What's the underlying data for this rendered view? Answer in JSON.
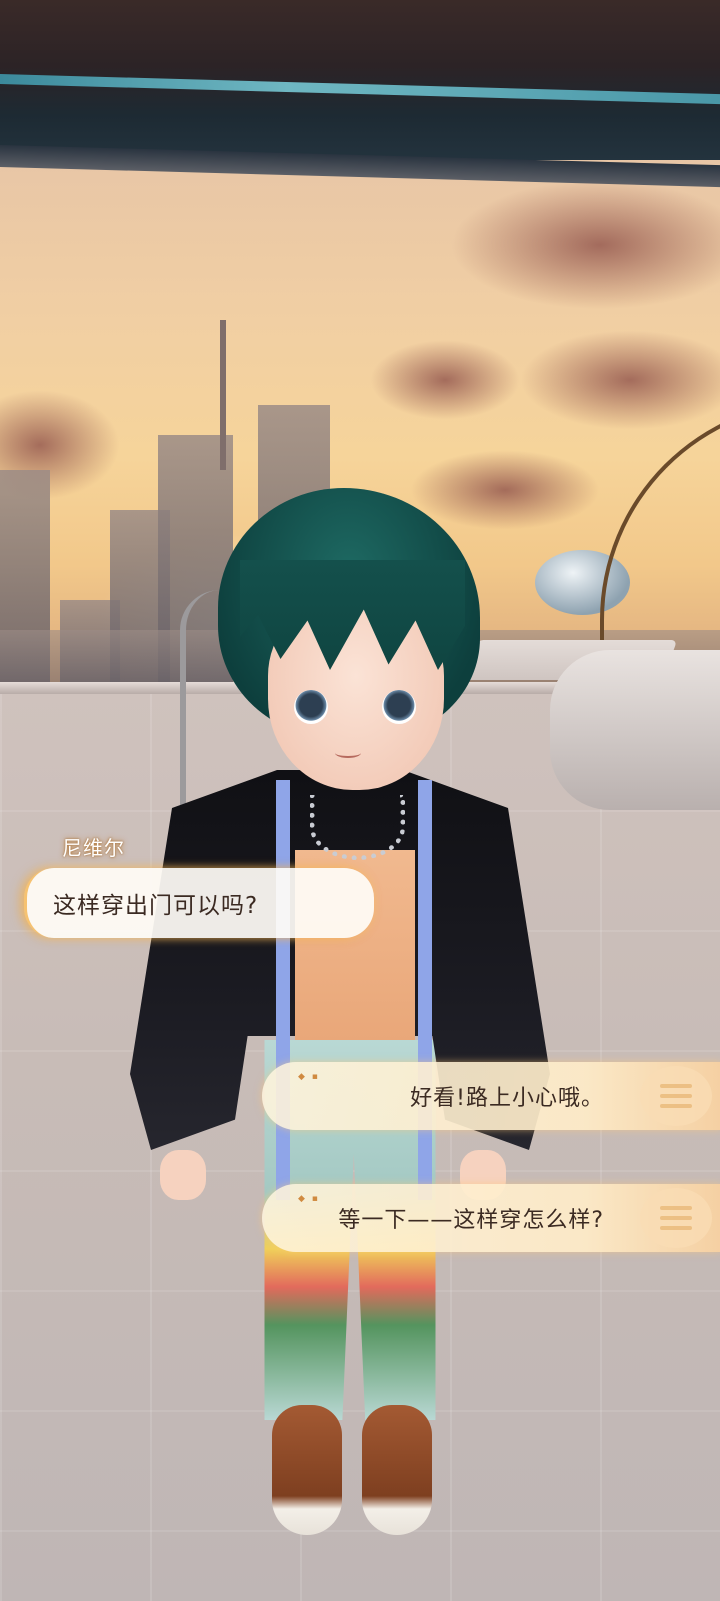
{
  "dialogue": {
    "speaker": "尼维尔",
    "line": "这样穿出门可以吗?"
  },
  "options": [
    {
      "marker": "◆ ▪",
      "text": "好看!路上小心哦。",
      "icon": "chat-bubble-icon"
    },
    {
      "marker": "◆ ▪",
      "text": "等一下——这样穿怎么样?",
      "icon": "chat-bubble-icon"
    }
  ],
  "colors": {
    "bubble_glow": "#f4b85a",
    "text": "#3b2a22",
    "name_glow": "#be7828"
  }
}
